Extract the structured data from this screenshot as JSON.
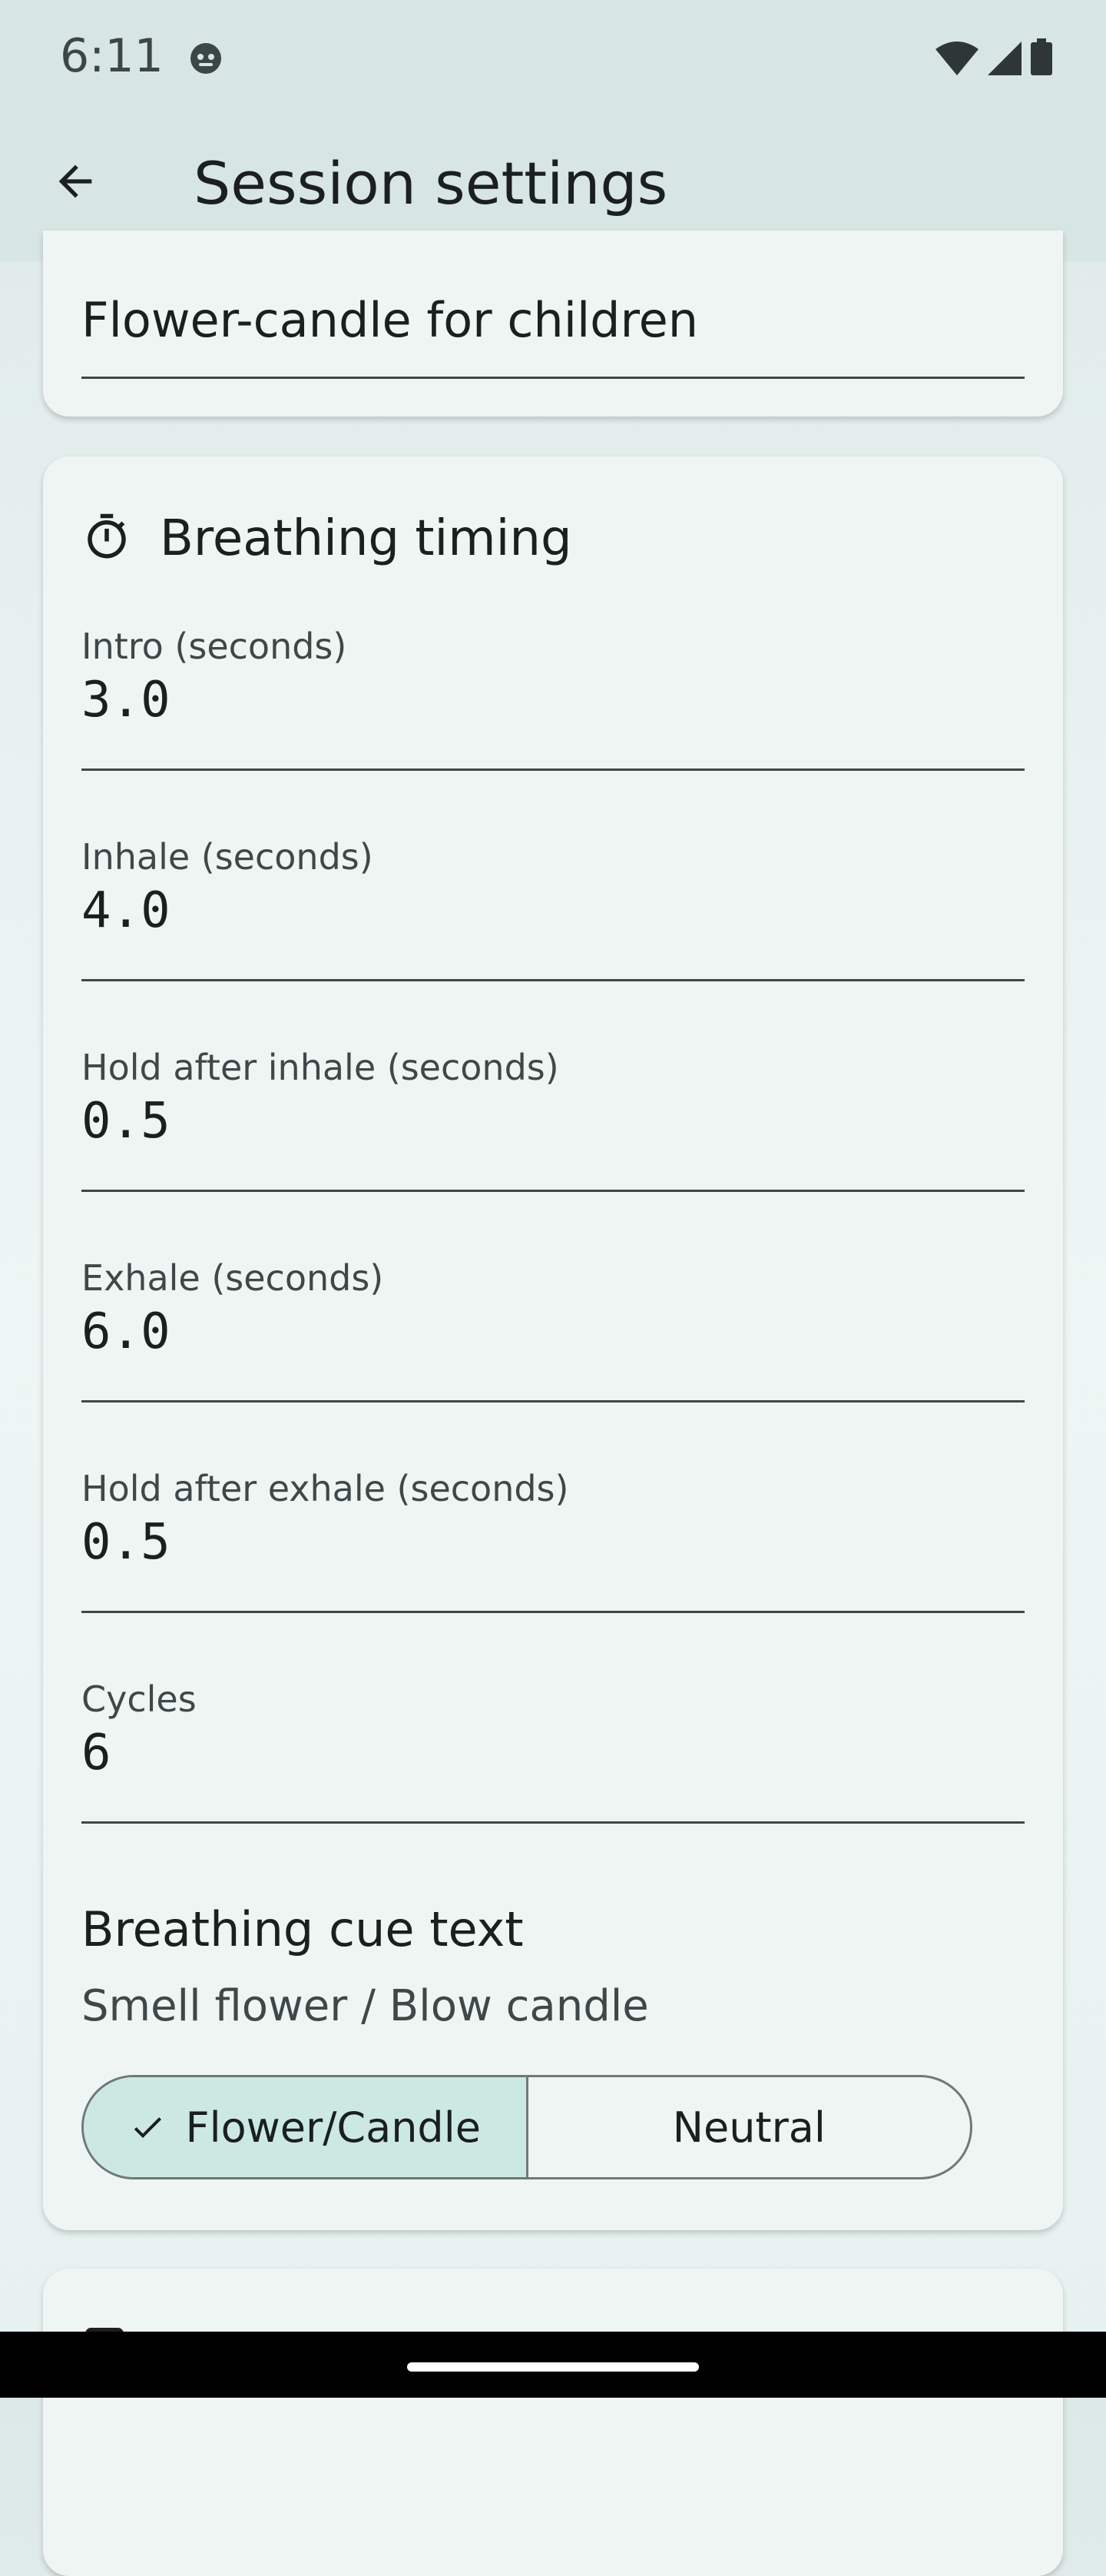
{
  "status_bar": {
    "time": "6:11",
    "icons": [
      "robot-icon",
      "wifi-icon",
      "cell-signal-icon",
      "battery-icon"
    ]
  },
  "app_bar": {
    "title": "Session settings",
    "back_icon": "arrow-back-icon"
  },
  "session_name": {
    "value": "Flower-candle for children"
  },
  "breathing_timing": {
    "title": "Breathing timing",
    "icon": "timer-icon",
    "fields": [
      {
        "label": "Intro (seconds)",
        "value": "3.0"
      },
      {
        "label": "Inhale (seconds)",
        "value": "4.0"
      },
      {
        "label": "Hold after inhale (seconds)",
        "value": "0.5"
      },
      {
        "label": "Exhale (seconds)",
        "value": "6.0"
      },
      {
        "label": "Hold after exhale (seconds)",
        "value": "0.5"
      },
      {
        "label": "Cycles",
        "value": "6"
      }
    ],
    "cue": {
      "title": "Breathing cue text",
      "subtitle": "Smell flower / Blow candle",
      "options": [
        "Flower/Candle",
        "Neutral"
      ],
      "selected": "Flower/Candle"
    }
  },
  "colors": {
    "app_bar_bg": "#d7e5e3",
    "card_bg": "#eff5f3",
    "selected_segment": "#cce8e2"
  }
}
